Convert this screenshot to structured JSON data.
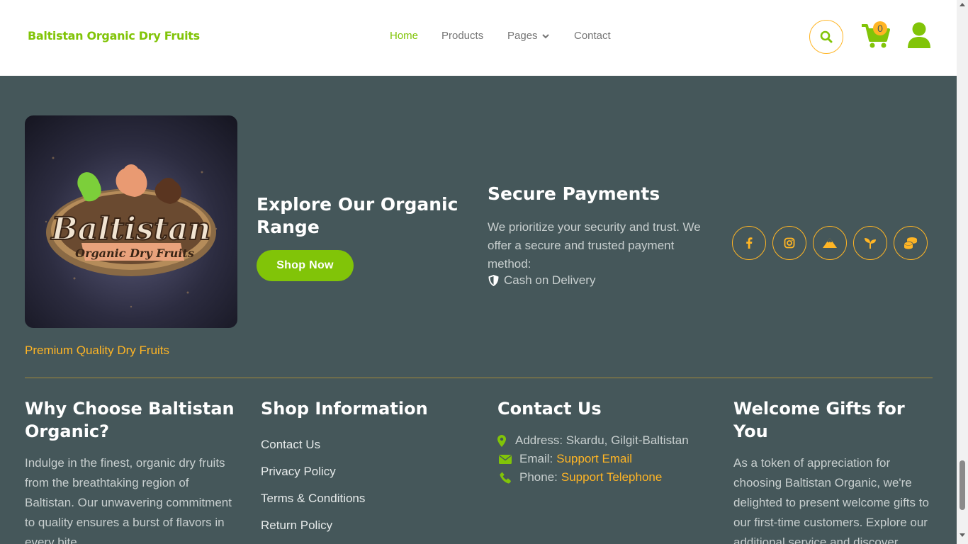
{
  "header": {
    "brand": "Baltistan Organic Dry Fruits",
    "nav": [
      {
        "label": "Home",
        "active": true
      },
      {
        "label": "Products"
      },
      {
        "label": "Pages"
      },
      {
        "label": "Contact"
      }
    ],
    "cart_count": "0",
    "icons": [
      "search-icon",
      "cart-icon",
      "user-icon"
    ]
  },
  "logo": {
    "line1": "Baltistan",
    "line2": "Organic Dry Fruits"
  },
  "tagline": "Premium Quality Dry Fruits",
  "explore": {
    "title": "Explore Our Organic Range",
    "button": "Shop Now"
  },
  "secure": {
    "title": "Secure Payments",
    "text": "We prioritize your security and trust. We offer a secure and trusted payment method:",
    "method": "Cash on Delivery"
  },
  "socials": [
    "facebook-icon",
    "instagram-icon",
    "mountain-icon",
    "seedling-icon",
    "coins-icon"
  ],
  "why": {
    "title": "Why Choose Baltistan Organic?",
    "text": "Indulge in the finest, organic dry fruits from the breathtaking region of Baltistan. Our unwavering commitment to quality ensures a burst of flavors in every bite."
  },
  "shop_info": {
    "title": "Shop Information",
    "links": [
      "Contact Us",
      "Privacy Policy",
      "Terms & Conditions",
      "Return Policy"
    ]
  },
  "contact": {
    "title": "Contact Us",
    "address": "Address: Skardu, Gilgit-Baltistan",
    "email_label": "Email:",
    "email_link": "Support Email",
    "phone_label": "Phone:",
    "phone_link": "Support Telephone"
  },
  "gifts": {
    "title": "Welcome Gifts for You",
    "text": "As a token of appreciation for choosing Baltistan Organic, we're delighted to present welcome gifts to our first-time customers. Explore our additional service and discover"
  },
  "colors": {
    "brand_green": "#81c408",
    "accent_orange": "#ffb524",
    "footer_bg": "#45575a"
  }
}
